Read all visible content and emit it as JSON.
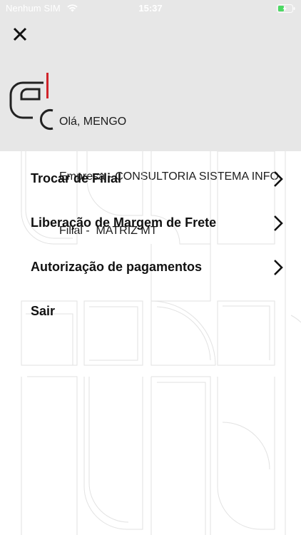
{
  "status_bar": {
    "carrier": "Nenhum SIM",
    "time": "15:37",
    "wifi_icon": "wifi-icon",
    "battery_icon": "battery-charging-icon",
    "battery_color": "#4cd964"
  },
  "header": {
    "close_icon": "close-icon",
    "logo_icon": "company-logo-ec",
    "greeting": "Olá, MENGO",
    "company": "Empresa - CONSULTORIA SISTEMA INFO",
    "branch": "Filial -  MATRIZ MT",
    "background_color": "#e7e7e7",
    "logo_accent_color": "#d0242a"
  },
  "menu": {
    "items": [
      {
        "label": "Trocar de Filial",
        "icon": "chevron-right-icon"
      },
      {
        "label": "Liberação de Margem de Frete",
        "icon": "chevron-right-icon"
      },
      {
        "label": "Autorização de pagamentos",
        "icon": "chevron-right-icon"
      },
      {
        "label": "Sair"
      }
    ]
  }
}
